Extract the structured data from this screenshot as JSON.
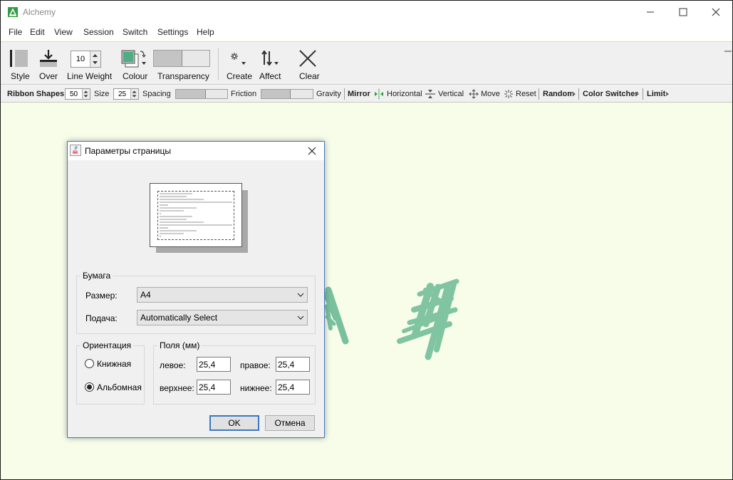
{
  "window": {
    "title": "Alchemy",
    "brand_color": "#2e9e3e"
  },
  "menu": [
    "File",
    "Edit",
    "View",
    "Session",
    "Switch",
    "Settings",
    "Help"
  ],
  "toolbar": {
    "style_label": "Style",
    "over_label": "Over",
    "line_weight_label": "Line Weight",
    "line_weight_value": "10",
    "colour_label": "Colour",
    "transparency_label": "Transparency",
    "create_label": "Create",
    "affect_label": "Affect",
    "clear_label": "Clear"
  },
  "toolbar2": {
    "ribbon_shapes": "Ribbon Shapes",
    "size_value": "50",
    "size_label": "Size",
    "spacing_value": "25",
    "spacing_label": "Spacing",
    "friction_label": "Friction",
    "gravity_label": "Gravity",
    "mirror": "Mirror",
    "horizontal": "Horizontal",
    "vertical": "Vertical",
    "move": "Move",
    "reset": "Reset",
    "random": "Random",
    "color_switcher": "Color Switcher",
    "limit": "Limit"
  },
  "dialog": {
    "title": "Параметры страницы",
    "paper_group": "Бумага",
    "size_label": "Размер:",
    "size_value": "A4",
    "source_label": "Подача:",
    "source_value": "Automatically Select",
    "orientation_group": "Ориентация",
    "portrait": "Книжная",
    "landscape": "Альбомная",
    "orientation_selected": "landscape",
    "margins_group": "Поля (мм)",
    "left_label": "левое:",
    "left_value": "25,4",
    "right_label": "правое:",
    "right_value": "25,4",
    "top_label": "верхнее:",
    "top_value": "25,4",
    "bottom_label": "нижнее:",
    "bottom_value": "25,4",
    "ok": "OK",
    "cancel": "Отмена"
  },
  "colors": {
    "canvas_bg": "#f8fdea",
    "stroke_color": "#4fad84",
    "accent": "#3c78c4"
  }
}
